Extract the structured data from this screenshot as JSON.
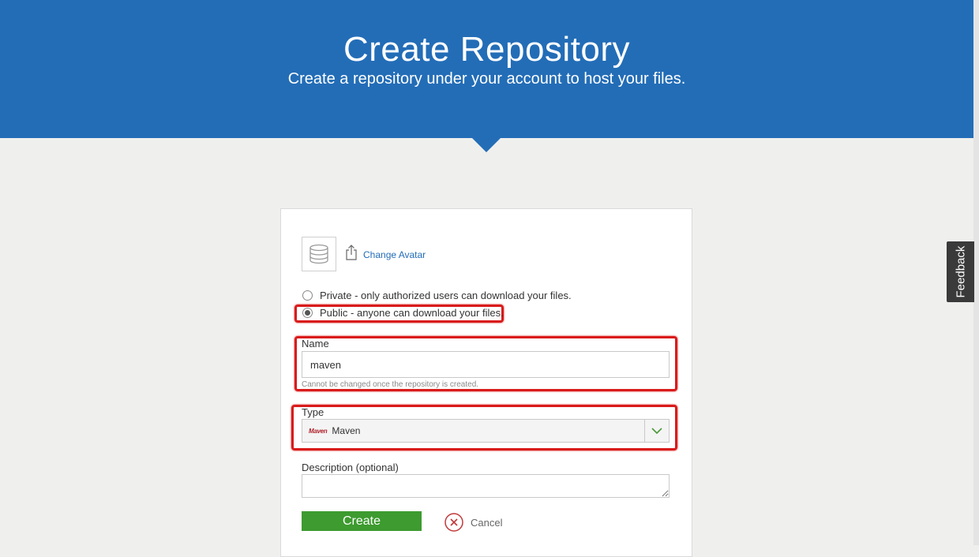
{
  "header": {
    "title": "Create Repository",
    "subtitle": "Create a repository under your account to host your files."
  },
  "feedback_tab": {
    "label": "Feedback"
  },
  "form": {
    "change_avatar_label": "Change Avatar",
    "visibility_options": [
      {
        "label": "Private - only authorized users can download your files.",
        "selected": false
      },
      {
        "label": "Public - anyone can download your files.",
        "selected": true
      }
    ],
    "name": {
      "label": "Name",
      "value": "maven",
      "hint": "Cannot be changed once the repository is created."
    },
    "type": {
      "label": "Type",
      "logo_text": "Maven",
      "selected": "Maven"
    },
    "description": {
      "label": "Description (optional)",
      "value": ""
    },
    "create_label": "Create",
    "cancel_label": "Cancel"
  },
  "colors": {
    "header_bg": "#236db7",
    "page_bg": "#eff0ed",
    "highlight": "#d91b1b",
    "create_button": "#3d9b2f"
  }
}
